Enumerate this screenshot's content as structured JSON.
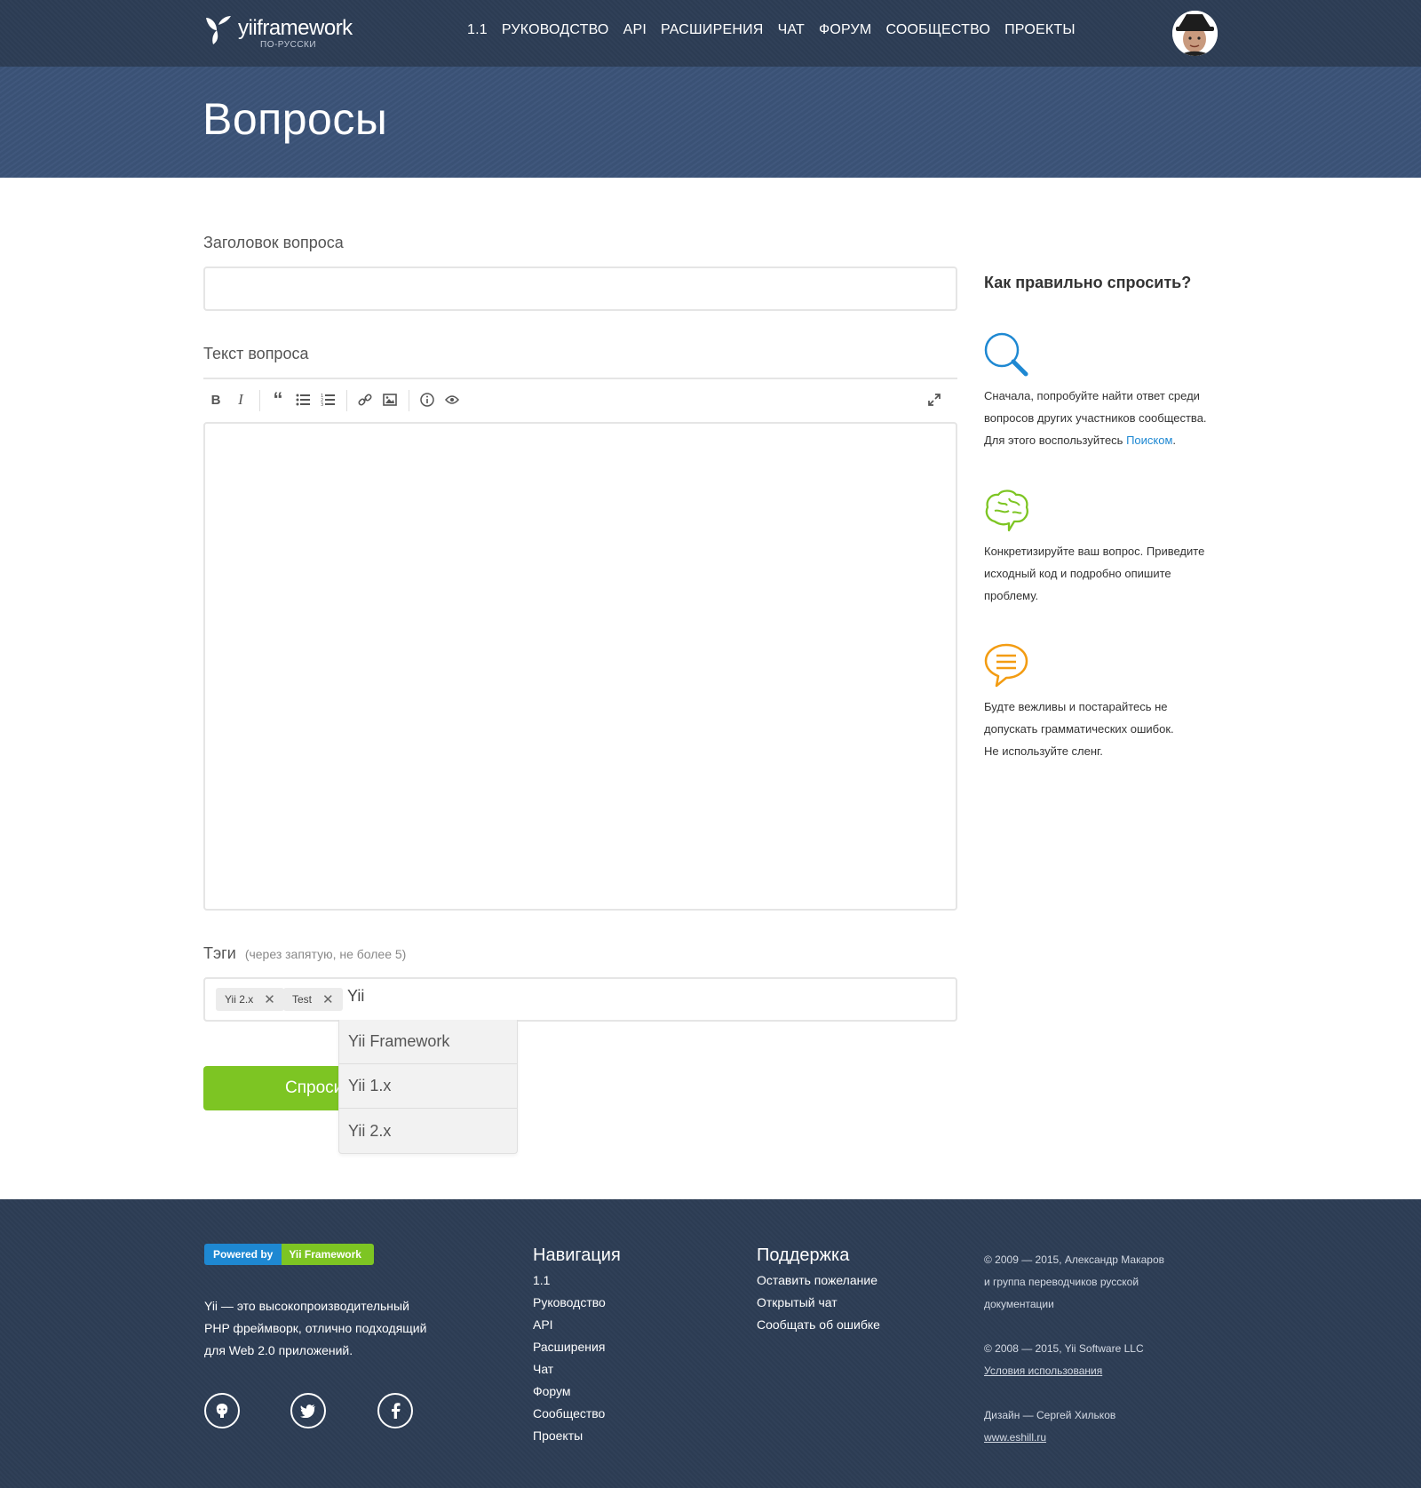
{
  "header": {
    "logo_text": "yiiframework",
    "logo_sub": "ПО-РУССКИ",
    "nav": [
      "1.1",
      "РУКОВОДСТВО",
      "API",
      "РАСШИРЕНИЯ",
      "ЧАТ",
      "ФОРУМ",
      "СООБЩЕСТВО",
      "ПРОЕКТЫ"
    ]
  },
  "page_title": "Вопросы",
  "form": {
    "title_label": "Заголовок вопроса",
    "title_value": "",
    "text_label": "Текст вопроса",
    "text_value": "",
    "toolbar": [
      "bold-icon",
      "italic-icon",
      "quote-icon",
      "unordered-list-icon",
      "ordered-list-icon",
      "link-icon",
      "image-icon",
      "info-icon",
      "preview-icon",
      "fullscreen-icon"
    ],
    "tags_label": "Тэги",
    "tags_hint": "(через запятую, не более 5)",
    "tags": [
      "Yii 2.x",
      "Test"
    ],
    "tag_input_value": "Yii",
    "submit_label": "Спроси",
    "suggestions": [
      "Yii Framework",
      "Yii 1.x",
      "Yii 2.x"
    ]
  },
  "sidebar": {
    "title": "Как правильно спросить?",
    "tips": [
      {
        "icon": "search-icon",
        "color": "#1e88d2",
        "lines": [
          "Сначала, попробуйте найти ответ среди",
          "вопросов других участников сообщества.",
          "Для этого воспользуйтесь "
        ],
        "link": "Поиском",
        "suffix": "."
      },
      {
        "icon": "brain-icon",
        "color": "#7dc523",
        "lines": [
          "Конкретизируйте ваш вопрос. Приведите",
          "исходный код и подробно опишите",
          "проблему."
        ]
      },
      {
        "icon": "speech-bubble-icon",
        "color": "#f39c12",
        "lines": [
          "Будте вежливы и постарайтесь не",
          "допускать грамматических ошибок.",
          "Не используйте сленг."
        ]
      }
    ]
  },
  "footer": {
    "powered_by": "Powered by",
    "powered_name": "Yii Framework",
    "description_lines": [
      "Yii — это высокопроизводительный",
      "PHP фреймворк, отлично подходящий",
      "для Web 2.0 приложений."
    ],
    "social": [
      "github-icon",
      "twitter-icon",
      "facebook-icon"
    ],
    "nav_title": "Навигация",
    "nav_links": [
      "1.1",
      "Руководство",
      "API",
      "Расширения",
      "Чат",
      "Форум",
      "Сообщество",
      "Проекты"
    ],
    "support_title": "Поддержка",
    "support_links": [
      "Оставить пожелание",
      "Открытый чат",
      "Сообщать об ошибке"
    ],
    "copyright1_lines": [
      "© 2009 — 2015, Александр Макаров",
      "и группа переводчиков русской",
      "документации"
    ],
    "copyright2": "© 2008 — 2015, Yii Software LLC",
    "terms": "Условия использования",
    "design": "Дизайн — Сергей Хильков",
    "design_site": "www.eshill.ru"
  }
}
